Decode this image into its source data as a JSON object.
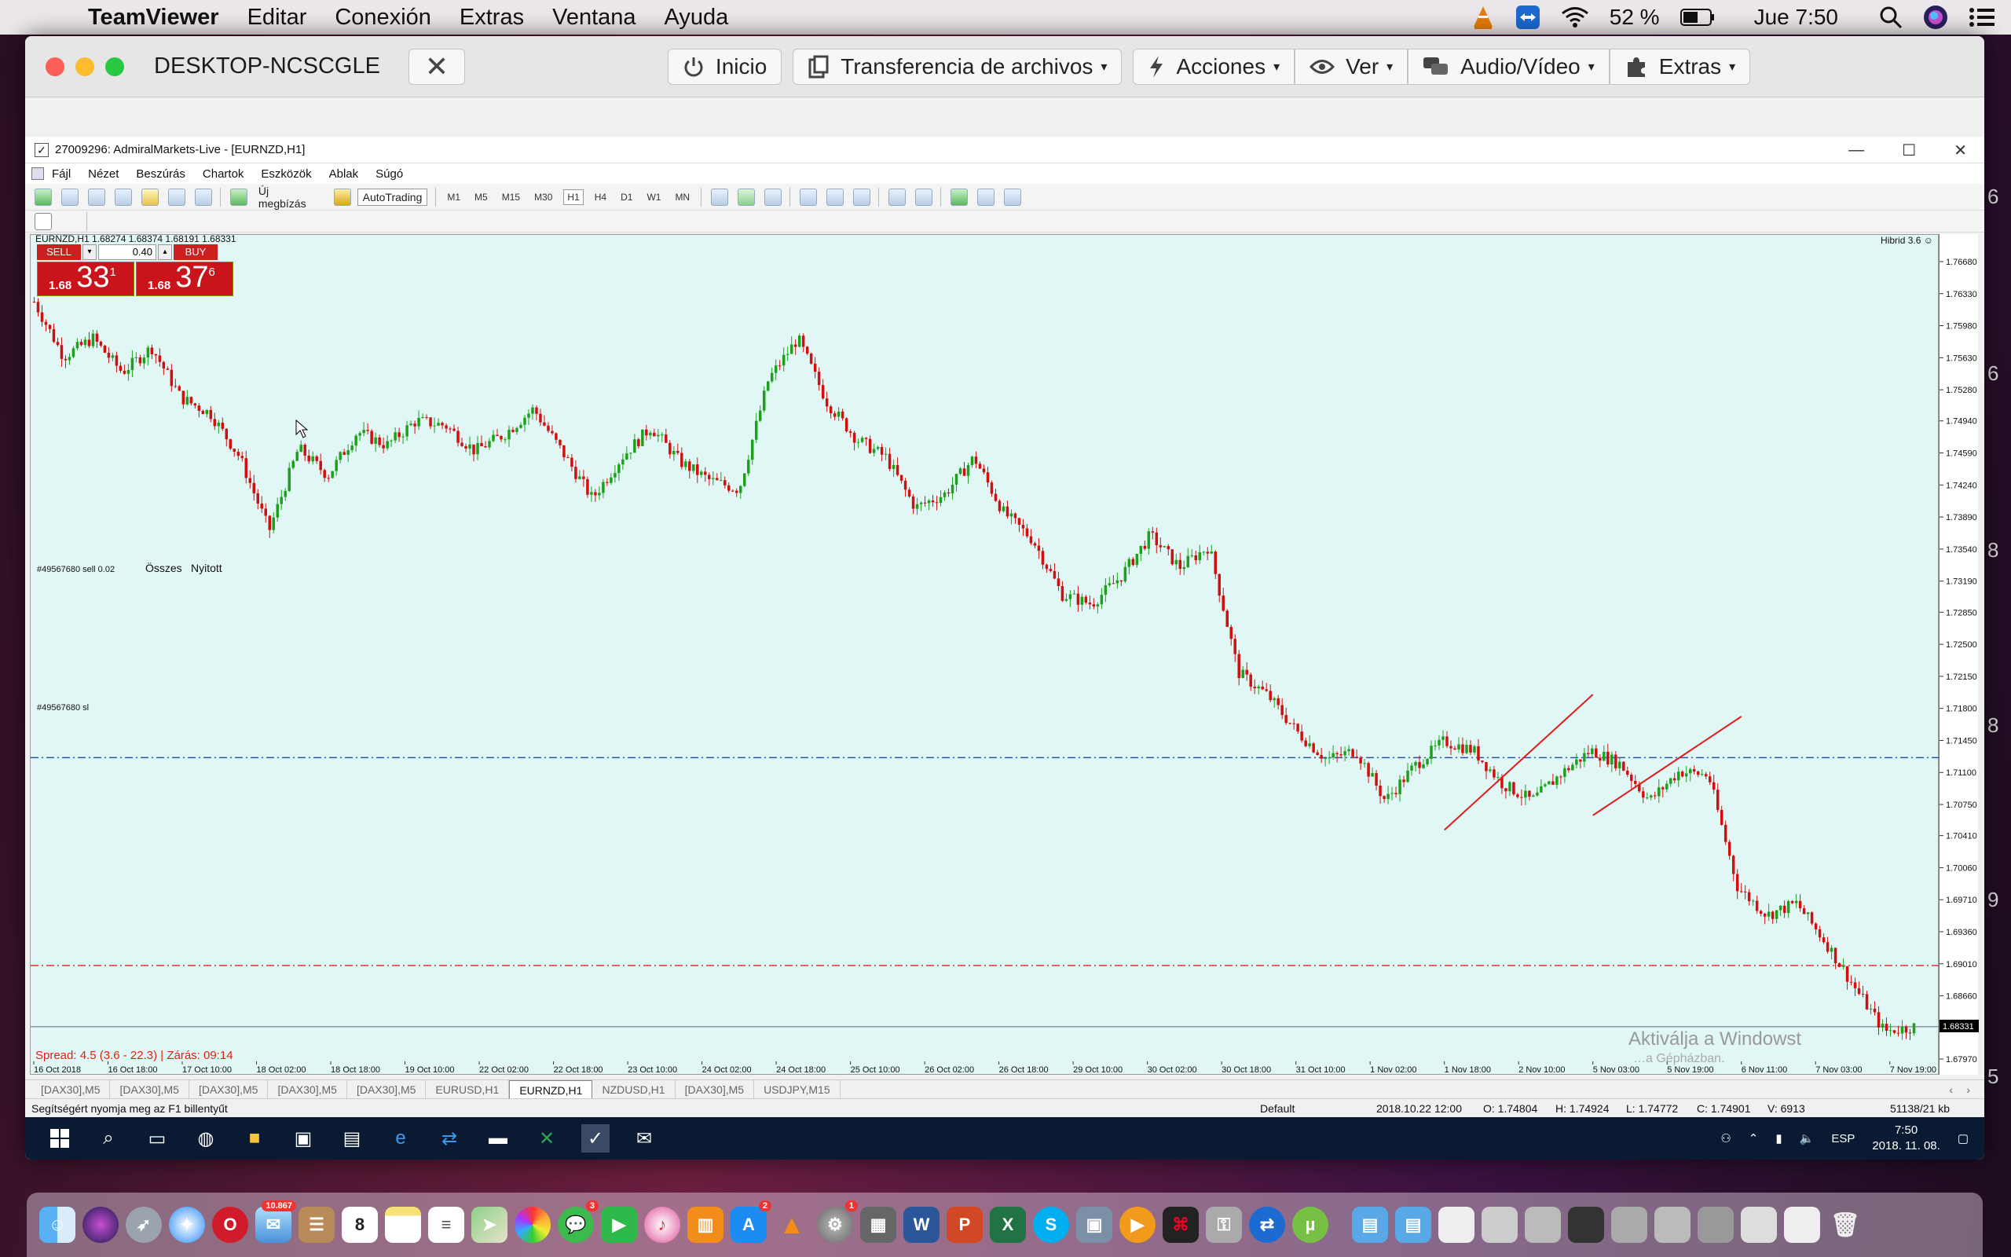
{
  "mac_menubar": {
    "app_name": "TeamViewer",
    "menus": [
      "Editar",
      "Conexión",
      "Extras",
      "Ventana",
      "Ayuda"
    ],
    "battery": "52 %",
    "clock": "Jue 7:50"
  },
  "teamviewer": {
    "partner_id": "DESKTOP-NCSCGLE",
    "close_label": "✕",
    "buttons": {
      "inicio": "Inicio",
      "transfer": "Transferencia de archivos",
      "acciones": "Acciones",
      "ver": "Ver",
      "audio": "Audio/Vídeo",
      "extras": "Extras"
    }
  },
  "mt4": {
    "window_title": "27009296: AdmiralMarkets-Live - [EURNZD,H1]",
    "menu": [
      "Fájl",
      "Nézet",
      "Beszúrás",
      "Chartok",
      "Eszközök",
      "Ablak",
      "Súgó"
    ],
    "toolbar": {
      "new_order": "Új megbízás",
      "autotrading": "AutoTrading",
      "timeframes": [
        "M1",
        "M5",
        "M15",
        "M30",
        "H1",
        "H4",
        "D1",
        "W1",
        "MN"
      ],
      "active_timeframe": "H1"
    },
    "chart": {
      "symbol_info": "EURNZD,H1  1.68274 1.68374 1.68191 1.68331",
      "hibrid": "Hibrid 3.6 ☺",
      "trade_panel": {
        "sell": "SELL",
        "buy": "BUY",
        "lot": "0.40",
        "sell_price_small": "1.68",
        "sell_price_big": "33",
        "sell_price_sup": "1",
        "buy_price_small": "1.68",
        "buy_price_big": "37",
        "buy_price_sup": "6"
      },
      "order_label": "#49567680 sell 0.02",
      "osszes": "Összes",
      "nyitott": "Nyitott",
      "sl_label": "#49567680 sl",
      "spread_info": "Spread: 4.5 (3.6 - 22.3)  |  Zárás: 09:14",
      "watermark": "Aktiválja a Windowst",
      "watermark_sub": "…a Gépházban.",
      "current_price": "1.68331"
    },
    "tabs": [
      "[DAX30],M5",
      "[DAX30],M5",
      "[DAX30],M5",
      "[DAX30],M5",
      "[DAX30],M5",
      "EURUSD,H1",
      "EURNZD,H1",
      "NZDUSD,H1",
      "[DAX30],M5",
      "USDJPY,M15"
    ],
    "active_tab": "EURNZD,H1",
    "status": {
      "help": "Segítségért nyomja meg az F1 billentyűt",
      "profile": "Default",
      "datetime": "2018.10.22 12:00",
      "open": "O: 1.74804",
      "high": "H: 1.74924",
      "low": "L: 1.74772",
      "close": "C: 1.74901",
      "volume": "V: 6913",
      "traffic": "51138/21 kb"
    }
  },
  "windows_taskbar": {
    "lang": "ESP",
    "time": "7:50",
    "date": "2018. 11. 08."
  },
  "dock": {
    "mail_badge": "10.867",
    "calendar_day": "8",
    "messages_badge": "3",
    "appstore_badge": "2",
    "prefs_badge": "1"
  },
  "chart_data": {
    "type": "candlestick",
    "symbol": "EURNZD",
    "timeframe": "H1",
    "x_tick_labels": [
      "16 Oct 2018",
      "16 Oct 18:00",
      "17 Oct 10:00",
      "18 Oct 02:00",
      "18 Oct 18:00",
      "19 Oct 10:00",
      "22 Oct 02:00",
      "22 Oct 18:00",
      "23 Oct 10:00",
      "24 Oct 02:00",
      "24 Oct 18:00",
      "25 Oct 10:00",
      "26 Oct 02:00",
      "26 Oct 18:00",
      "29 Oct 10:00",
      "30 Oct 02:00",
      "30 Oct 18:00",
      "31 Oct 10:00",
      "1 Nov 02:00",
      "1 Nov 18:00",
      "2 Nov 10:00",
      "5 Nov 03:00",
      "5 Nov 19:00",
      "6 Nov 11:00",
      "7 Nov 03:00",
      "7 Nov 19:00"
    ],
    "y_tick_labels": [
      "1.76680",
      "1.76330",
      "1.75980",
      "1.75630",
      "1.75280",
      "1.74940",
      "1.74590",
      "1.74240",
      "1.73890",
      "1.73540",
      "1.73190",
      "1.72850",
      "1.72500",
      "1.72150",
      "1.71800",
      "1.71450",
      "1.71100",
      "1.70750",
      "1.70410",
      "1.70060",
      "1.69710",
      "1.69360",
      "1.69010",
      "1.68660",
      "1.68310",
      "1.67970"
    ],
    "ylim": [
      1.6797,
      1.7686
    ],
    "close_path": [
      1.7625,
      1.7565,
      1.7585,
      1.7548,
      1.7575,
      1.752,
      1.7503,
      1.7455,
      1.7375,
      1.7465,
      1.7435,
      1.7483,
      1.7468,
      1.7495,
      1.749,
      1.7462,
      1.748,
      1.7508,
      1.746,
      1.741,
      1.7455,
      1.7488,
      1.745,
      1.743,
      1.742,
      1.754,
      1.7585,
      1.7515,
      1.7475,
      1.7455,
      1.74,
      1.7415,
      1.7455,
      1.7395,
      1.7365,
      1.7305,
      1.7295,
      1.7325,
      1.737,
      1.7335,
      1.7358,
      1.722,
      1.7195,
      1.7155,
      1.7125,
      1.7135,
      1.708,
      1.7118,
      1.7145,
      1.7135,
      1.7098,
      1.708,
      1.711,
      1.7135,
      1.712,
      1.708,
      1.7112,
      1.7108,
      1.6985,
      1.6955,
      1.6968,
      1.6925,
      1.6875,
      1.6828,
      1.6833
    ],
    "series_lines": [
      {
        "name": "#49567680 sell 0.02",
        "value": 1.7127
      },
      {
        "name": "#49567680 sl",
        "value": 1.69
      }
    ],
    "trendlines": [
      {
        "from": [
          "1 Nov 18:00",
          1.7048
        ],
        "to": [
          "5 Nov 03:00",
          1.7196
        ]
      },
      {
        "from": [
          "5 Nov 03:00",
          1.7064
        ],
        "to": [
          "6 Nov 11:00",
          1.7172
        ]
      }
    ]
  }
}
